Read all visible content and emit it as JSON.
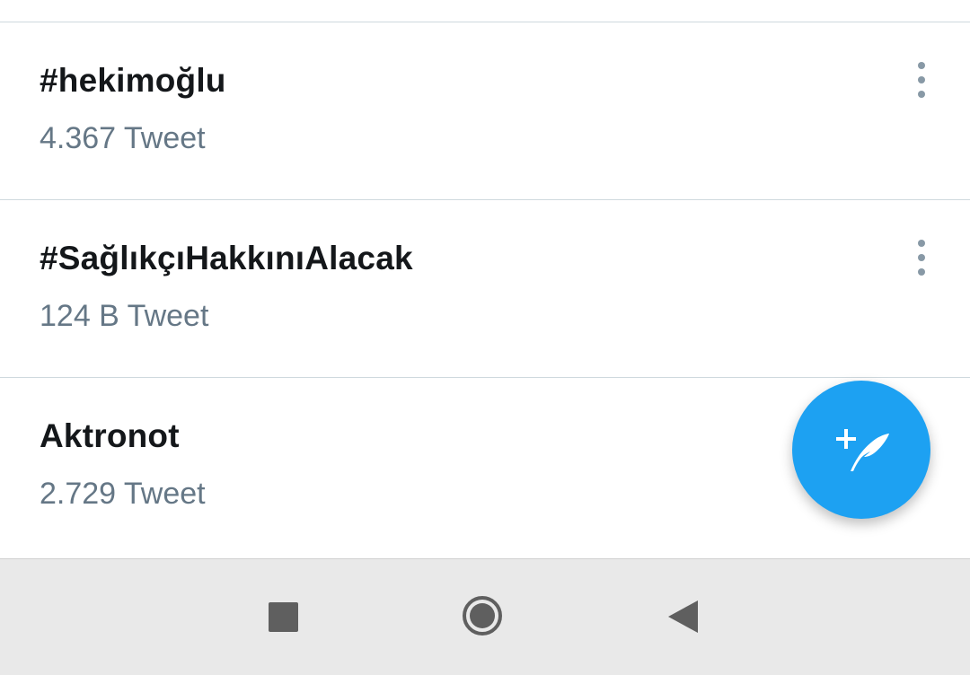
{
  "trends": [
    {
      "title": "#hekimoğlu",
      "count": "4.367 Tweet",
      "has_more": true
    },
    {
      "title": "#SağlıkçıHakkınıAlacak",
      "count": "124 B Tweet",
      "has_more": true
    },
    {
      "title": "Aktronot",
      "count": "2.729 Tweet",
      "has_more": false
    }
  ],
  "fab": {
    "icon": "compose-tweet-icon",
    "color": "#1da1f2"
  },
  "nav_bar": {
    "icons": [
      "recent-apps-icon",
      "home-icon",
      "back-icon"
    ]
  },
  "colors": {
    "accent": "#1da1f2",
    "title_text": "#14171a",
    "secondary_text": "#657786",
    "divider": "#cfd9de"
  }
}
